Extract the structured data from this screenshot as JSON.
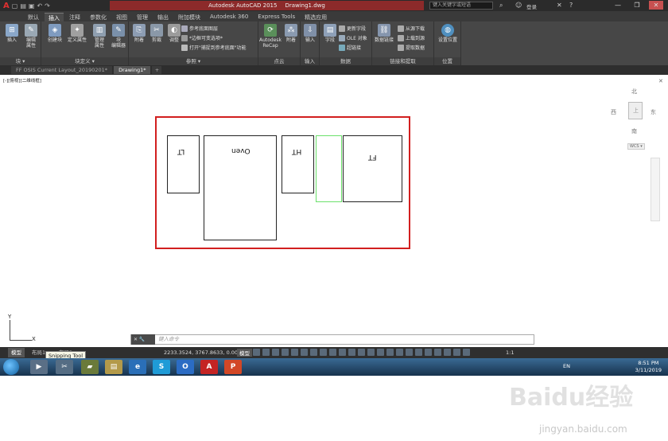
{
  "titlebar": {
    "product": "Autodesk AutoCAD 2015",
    "document": "Drawing1.dwg",
    "search_placeholder": "键入关键字或短语",
    "login": "登录"
  },
  "ribbon_tabs": [
    "默认",
    "插入",
    "注释",
    "参数化",
    "视图",
    "管理",
    "输出",
    "附加模块",
    "Autodesk 360",
    "Express Tools",
    "精选应用"
  ],
  "ribbon_active_tab": "插入",
  "ribbon": {
    "panel_block": {
      "title": "块 ▾",
      "insert": "插入",
      "edit_attr": "编辑\n属性"
    },
    "panel_define": {
      "title": "块定义 ▾",
      "create": "创建块",
      "define_attr": "定义属性",
      "manage_attr": "管理\n属性",
      "block_editor": "块\n编辑器"
    },
    "panel_ref": {
      "title": "参照 ▾",
      "attach": "附着",
      "clip": "剪裁",
      "adjust": "调整",
      "underlay_layers": "参考底面图层",
      "frame": "*边框可变选项*",
      "snap": "打开\"捕捉到参考底面\"功能"
    },
    "panel_pointcloud": {
      "title": "点云",
      "recap": "Autodesk\nReCap",
      "attach": "附着"
    },
    "panel_import": {
      "title": "输入",
      "import": "输入"
    },
    "panel_data": {
      "title": "数据",
      "field": "字段",
      "update_fields": "更新字段",
      "ole": "OLE 对象",
      "hyperlink": "超链接"
    },
    "panel_link": {
      "title": "链接和提取",
      "datalink": "数据链接",
      "download": "从源下载",
      "upload": "上载到源",
      "extract": "提取数据"
    },
    "panel_location": {
      "title": "位置",
      "set_location": "设置位置"
    }
  },
  "doc_tabs": [
    "FF OSIS Current Layout_20190201*",
    "Drawing1*",
    "+"
  ],
  "viewport_label": "[-][俯视][二维线框]",
  "viewcube": {
    "north": "北",
    "south": "南",
    "east": "东",
    "west": "西",
    "top": "上",
    "wcs": "WCS ▾"
  },
  "drawing_boxes": [
    {
      "label": "LT"
    },
    {
      "label": "Oven"
    },
    {
      "label": "HT"
    },
    {
      "label": ""
    },
    {
      "label": "FT"
    }
  ],
  "ucs": {
    "x": "X",
    "y": "Y"
  },
  "command_line": {
    "placeholder": "键入命令",
    "controls": "✕ 🔧"
  },
  "layout_tabs": [
    "模型",
    "布局1",
    "布局2"
  ],
  "tooltip": "Snipping Tool",
  "status": {
    "coords": "2233.3524, 3767.8633, 0.0000",
    "model": "模型",
    "scale": "1:1"
  },
  "taskbar": {
    "lang": "EN",
    "time": "8:51 PM",
    "date": "3/11/2019"
  },
  "watermark": {
    "brand": "Baidu经验",
    "url": "jingyan.baidu.com"
  }
}
